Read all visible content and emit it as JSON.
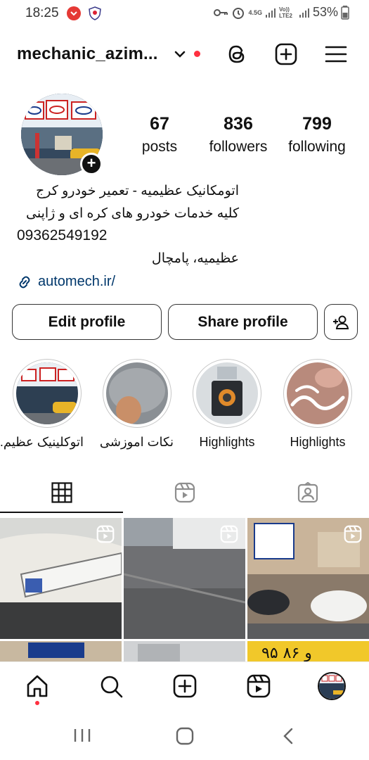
{
  "status_bar": {
    "time": "18:25",
    "network_1": "4.5G",
    "network_2": "Vo)) LTE2",
    "battery": "53%"
  },
  "header": {
    "username": "mechanic_azim...",
    "icons": [
      "chevron-down-icon",
      "threads-icon",
      "create-plus-icon",
      "menu-icon"
    ]
  },
  "profile": {
    "stats": {
      "posts_count": "67",
      "posts_label": "posts",
      "followers_count": "836",
      "followers_label": "followers",
      "following_count": "799",
      "following_label": "following"
    },
    "bio_line1": "اتومکانیک عظیمیه - تعمیر خودرو کرج",
    "bio_line2": "کلیه خدمات خودرو های کره ای و ژاپنی",
    "phone": "09362549192",
    "address": "عظیمیه، پامچال",
    "link": "automech.ir/"
  },
  "actions": {
    "edit_label": "Edit profile",
    "share_label": "Share profile"
  },
  "highlights": [
    {
      "label": "اتوکلینیک عظیم..."
    },
    {
      "label": "نکات اموزشی"
    },
    {
      "label": "Highlights"
    },
    {
      "label": "Highlights"
    }
  ],
  "tabs": [
    "grid-icon",
    "reels-icon",
    "tagged-icon"
  ],
  "bottom_nav": [
    "home-icon",
    "search-icon",
    "create-icon",
    "reels-icon",
    "profile-avatar"
  ],
  "colors": {
    "link": "#00376b",
    "notification": "#ff3040",
    "text": "#111111"
  }
}
